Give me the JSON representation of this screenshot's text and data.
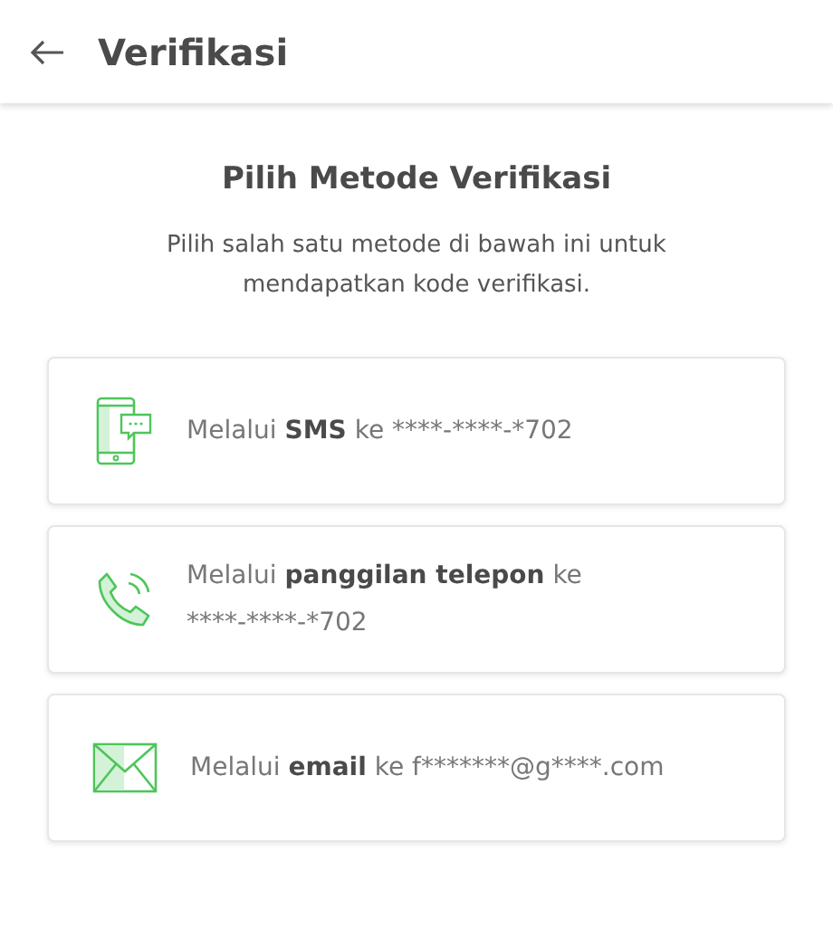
{
  "header": {
    "title": "Verifikasi"
  },
  "heading": "Pilih Metode Verifikasi",
  "description": "Pilih salah satu metode di bawah ini untuk mendapatkan kode verifikasi.",
  "methods": [
    {
      "kind": "sms",
      "prefix": "Melalui",
      "channel": "SMS",
      "suffix": "ke ****-****-*702"
    },
    {
      "kind": "phone",
      "prefix": "Melalui",
      "channel": "panggilan telepon",
      "suffix": "ke",
      "second_line": "****-****-*702"
    },
    {
      "kind": "email",
      "prefix": "Melalui",
      "channel": "email",
      "suffix": "ke f*******@g****.com"
    }
  ]
}
